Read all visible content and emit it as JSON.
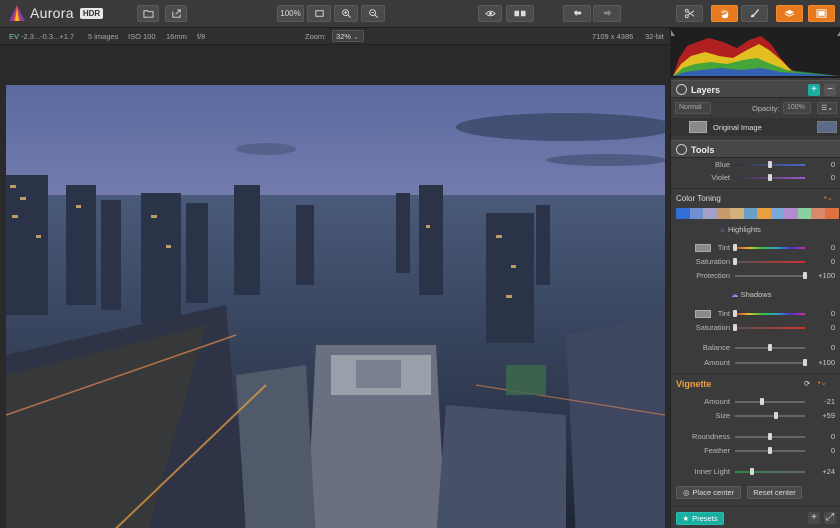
{
  "app": {
    "name": "Aurora",
    "badge": "HDR"
  },
  "toolbar": {
    "zoom_label": "100%",
    "icons": [
      "folder-open-icon",
      "export-icon",
      "zoom-100-icon",
      "fit-screen-icon",
      "zoom-in-icon",
      "zoom-out-icon",
      "eye-icon",
      "compare-split-icon",
      "undo-icon",
      "redo-icon",
      "crop-scissors-icon",
      "hand-tool-icon",
      "brush-tool-icon",
      "layers-stack-icon",
      "presets-grid-icon"
    ]
  },
  "infobar": {
    "ev_label": "EV",
    "ev_values": "-2.3...-0.3...+1.7",
    "images": "5 images",
    "iso": "ISO 100",
    "focal": "16mm",
    "aperture": "f/8",
    "zoom_label": "Zoom:",
    "zoom_value": "32%",
    "dimensions": "7109 x 4386",
    "bitdepth": "32-bit"
  },
  "layers": {
    "title": "Layers",
    "blend_mode": "Normal",
    "opacity_label": "Opacity:",
    "opacity_value": "100%",
    "item": "Original Image"
  },
  "tools": {
    "title": "Tools",
    "rows": [
      {
        "label": "Blue",
        "value": "0",
        "pos": 0.5
      },
      {
        "label": "Violet",
        "value": "0",
        "pos": 0.5
      }
    ]
  },
  "color_toning": {
    "title": "Color Toning",
    "swatches": [
      "#2f6fd6",
      "#6f8fd0",
      "#a4a0c8",
      "#c89a6a",
      "#d5b07a",
      "#6aa0c8",
      "#e8a040",
      "#7aa8d8",
      "#b48ad0",
      "#8ad0a0",
      "#d88a6a",
      "#e07040"
    ],
    "highlights": {
      "title": "Highlights",
      "rows": [
        {
          "label": "Tint",
          "value": "0",
          "pos": 0.0
        },
        {
          "label": "Saturation",
          "value": "0",
          "pos": 0.0
        },
        {
          "label": "Protection",
          "value": "+100",
          "pos": 1.0
        }
      ]
    },
    "shadows": {
      "title": "Shadows",
      "rows": [
        {
          "label": "Tint",
          "value": "0",
          "pos": 0.0
        },
        {
          "label": "Saturation",
          "value": "0",
          "pos": 0.0
        }
      ]
    },
    "balance": {
      "label": "Balance",
      "value": "0",
      "pos": 0.5
    },
    "amount": {
      "label": "Amount",
      "value": "+100",
      "pos": 1.0
    }
  },
  "vignette": {
    "title": "Vignette",
    "rows": [
      {
        "label": "Amount",
        "value": "-21",
        "pos": 0.39
      },
      {
        "label": "Size",
        "value": "+59",
        "pos": 0.59
      },
      {
        "label": "Roundness",
        "value": "0",
        "pos": 0.5
      },
      {
        "label": "Feather",
        "value": "0",
        "pos": 0.5
      },
      {
        "label": "Inner Light",
        "value": "+24",
        "pos": 0.24
      }
    ],
    "place_center": "Place center",
    "reset_center": "Reset center"
  },
  "presets_button": "Presets",
  "colors": {
    "accent_orange": "#e87a1e",
    "accent_teal": "#1aaea0"
  }
}
